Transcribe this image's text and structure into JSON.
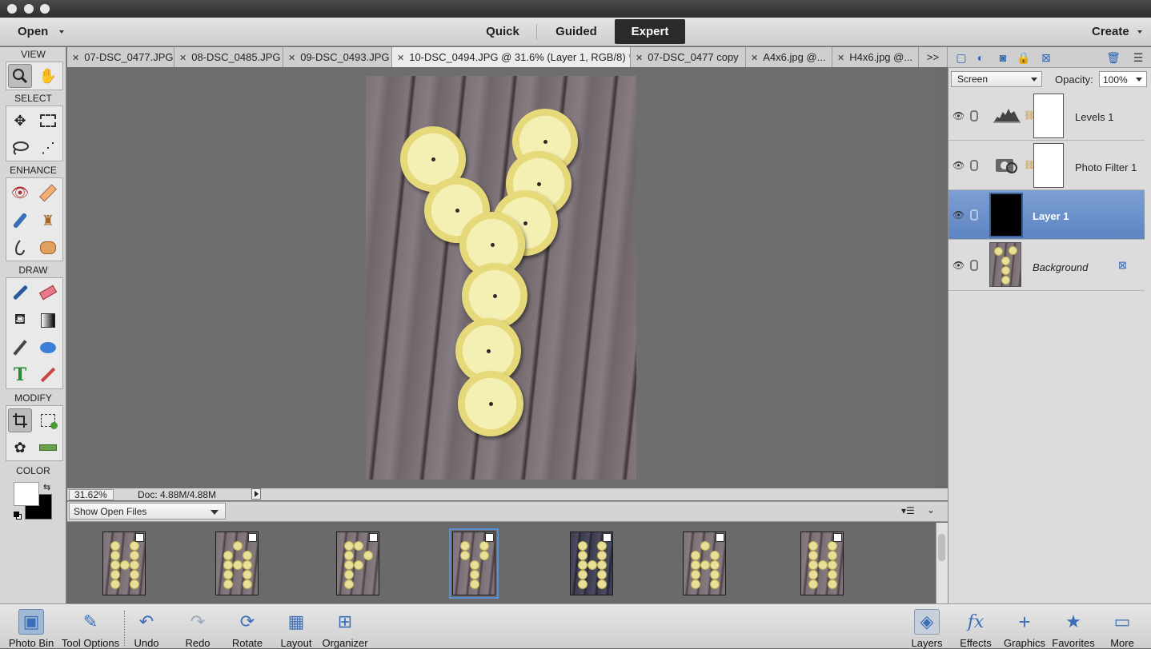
{
  "window": {
    "controls": [
      "close",
      "minimize",
      "zoom"
    ]
  },
  "menubar": {
    "open_label": "Open",
    "modes": [
      "Quick",
      "Guided",
      "Expert"
    ],
    "active_mode": "Expert",
    "create_label": "Create"
  },
  "toolbox": {
    "sections": [
      "VIEW",
      "SELECT",
      "ENHANCE",
      "DRAW",
      "MODIFY",
      "COLOR"
    ],
    "view_tools": [
      "zoom-icon",
      "hand-icon"
    ],
    "select_tools": [
      "move-icon",
      "marquee-icon",
      "lasso-icon",
      "magic-wand-icon"
    ],
    "enhance_tools": [
      "red-eye-icon",
      "healing-brush-icon",
      "smart-brush-icon",
      "clone-stamp-icon",
      "blur-icon",
      "sponge-icon"
    ],
    "draw_tools": [
      "brush-icon",
      "eraser-icon",
      "paint-bucket-icon",
      "gradient-icon",
      "eyedropper-icon",
      "shape-icon",
      "type-icon",
      "pencil-icon"
    ],
    "modify_tools": [
      "crop-icon",
      "recompose-icon",
      "content-aware-move-icon",
      "straighten-icon"
    ],
    "foreground": "#ffffff",
    "background": "#000000"
  },
  "tabs": [
    "07-DSC_0477.JPG",
    "08-DSC_0485.JPG",
    "09-DSC_0493.JPG",
    "10-DSC_0494.JPG @ 31.6% (Layer 1, RGB/8) *",
    "07-DSC_0477 copy",
    "A4x6.jpg @...",
    "H4x6.jpg @..."
  ],
  "tabs_overflow": ">>",
  "active_tab": 3,
  "status": {
    "zoom": "31.62%",
    "doc": "Doc: 4.88M/4.88M"
  },
  "photo_bin": {
    "filter": "Show Open Files",
    "thumbs": [
      "H",
      "A",
      "P",
      "Y",
      "H",
      "A",
      "H"
    ],
    "selected": 3
  },
  "bottom_left": [
    {
      "label": "Photo Bin",
      "icon": "photo-bin-icon"
    },
    {
      "label": "Tool Options",
      "icon": "tool-options-icon"
    },
    {
      "label": "Undo",
      "icon": "undo-icon"
    },
    {
      "label": "Redo",
      "icon": "redo-icon"
    },
    {
      "label": "Rotate",
      "icon": "rotate-icon"
    },
    {
      "label": "Layout",
      "icon": "layout-icon"
    },
    {
      "label": "Organizer",
      "icon": "organizer-icon"
    }
  ],
  "bottom_right": [
    {
      "label": "Layers",
      "icon": "layers-icon"
    },
    {
      "label": "Effects",
      "icon": "effects-icon"
    },
    {
      "label": "Graphics",
      "icon": "graphics-icon"
    },
    {
      "label": "Favorites",
      "icon": "favorites-icon"
    },
    {
      "label": "More",
      "icon": "more-icon"
    }
  ],
  "layers_panel": {
    "blend_mode": "Screen",
    "opacity_label": "Opacity:",
    "opacity": "100%",
    "layers": [
      {
        "name": "Levels 1",
        "type": "levels-icon"
      },
      {
        "name": "Photo Filter 1",
        "type": "photo-filter-icon"
      },
      {
        "name": "Layer 1",
        "selected": true
      },
      {
        "name": "Background",
        "locked": true
      }
    ]
  }
}
